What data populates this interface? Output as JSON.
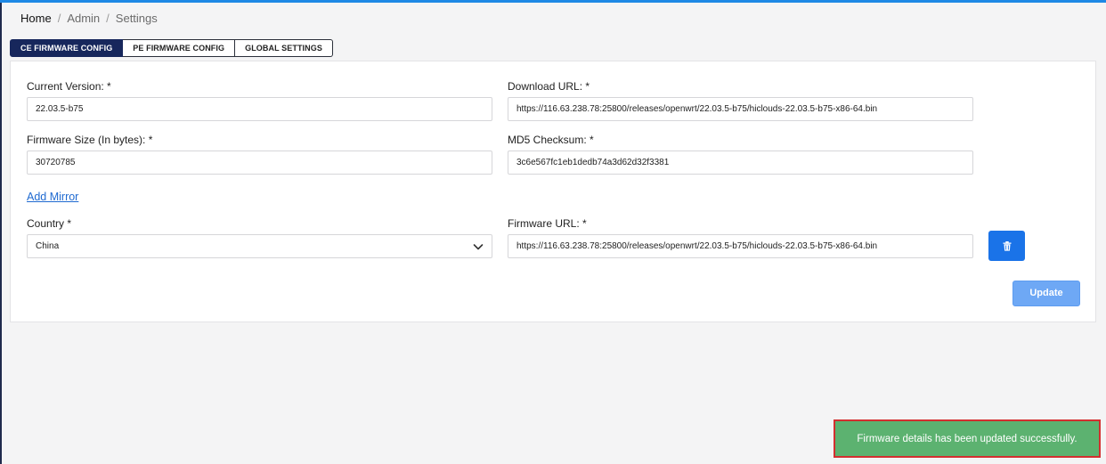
{
  "breadcrumb": {
    "home": "Home",
    "admin": "Admin",
    "settings": "Settings",
    "separator": "/"
  },
  "tabs": [
    {
      "label": "CE FIRMWARE CONFIG",
      "active": true
    },
    {
      "label": "PE FIRMWARE CONFIG",
      "active": false
    },
    {
      "label": "GLOBAL SETTINGS",
      "active": false
    }
  ],
  "form": {
    "current_version": {
      "label": "Current Version: *",
      "value": "22.03.5-b75"
    },
    "download_url": {
      "label": "Download URL: *",
      "value": "https://116.63.238.78:25800/releases/openwrt/22.03.5-b75/hiclouds-22.03.5-b75-x86-64.bin"
    },
    "firmware_size": {
      "label": "Firmware Size (In bytes): *",
      "value": "30720785"
    },
    "md5_checksum": {
      "label": "MD5 Checksum: *",
      "value": "3c6e567fc1eb1dedb74a3d62d32f3381"
    },
    "add_mirror": "Add Mirror",
    "country": {
      "label": "Country *",
      "value": "China"
    },
    "firmware_url": {
      "label": "Firmware URL: *",
      "value": "https://116.63.238.78:25800/releases/openwrt/22.03.5-b75/hiclouds-22.03.5-b75-x86-64.bin"
    },
    "update_button": "Update"
  },
  "toast": {
    "message": "Firmware details has been updated successfully."
  },
  "colors": {
    "accent": "#1a73e8",
    "active_tab": "#17275c",
    "update_button": "#6ea8f5",
    "toast_background": "#5cb270",
    "toast_border": "#d32f2f"
  },
  "icons": {
    "trash_button": "trash-icon",
    "country_select": "chevron-down-icon"
  }
}
